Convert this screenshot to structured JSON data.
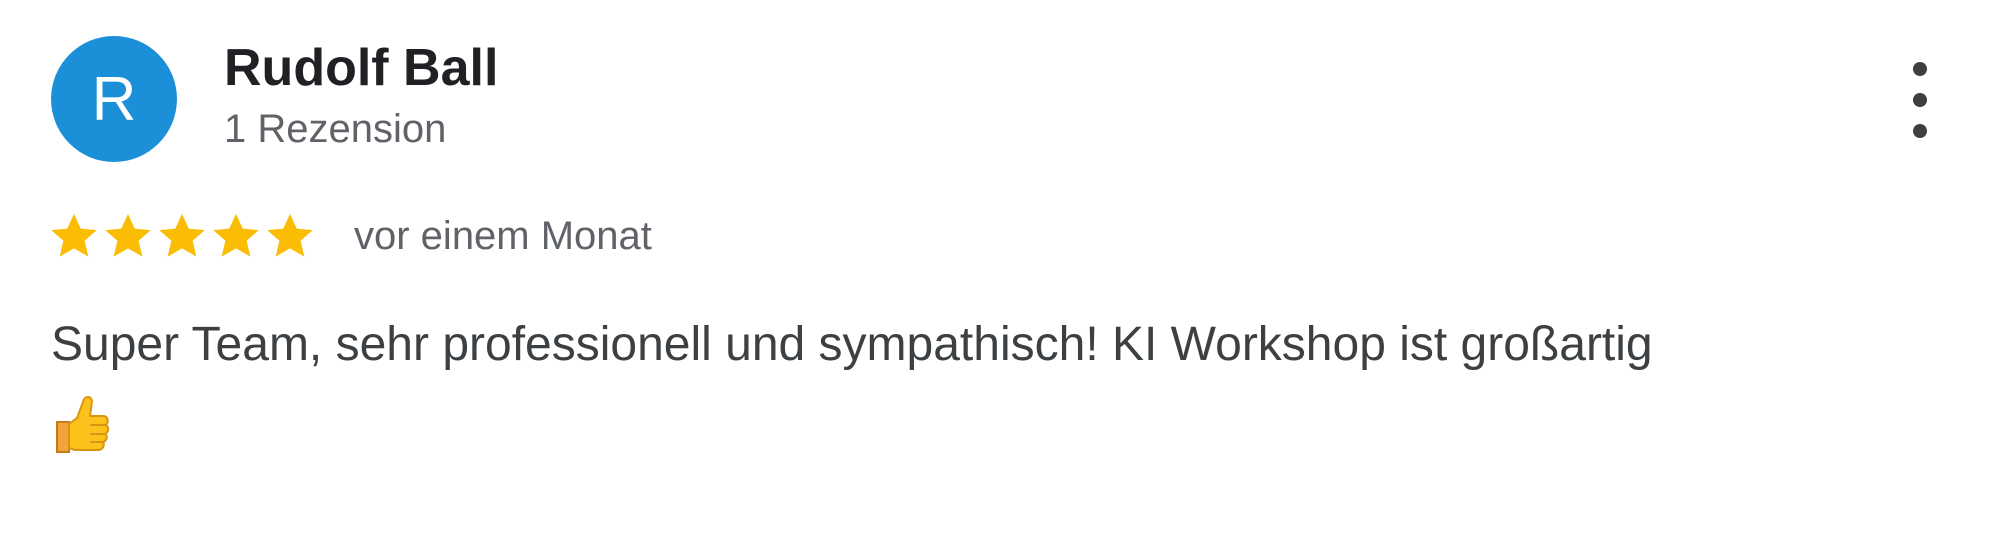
{
  "review": {
    "avatar_letter": "R",
    "author_name": "Rudolf Ball",
    "review_count": "1 Rezension",
    "rating": 5,
    "rating_max": 5,
    "date": "vor einem Monat",
    "text": "Super Team, sehr professionell und sympathisch! KI Workshop ist großartig",
    "emoji": "thumbs-up"
  },
  "colors": {
    "avatar": "#1b8fd8",
    "star": "#fbbc04",
    "name": "#202124",
    "secondary_text": "#5f6368",
    "body_text": "#3c4043"
  },
  "icons": {
    "more": "more-vert-icon",
    "star": "star-icon",
    "emoji": "thumbs-up-icon"
  }
}
